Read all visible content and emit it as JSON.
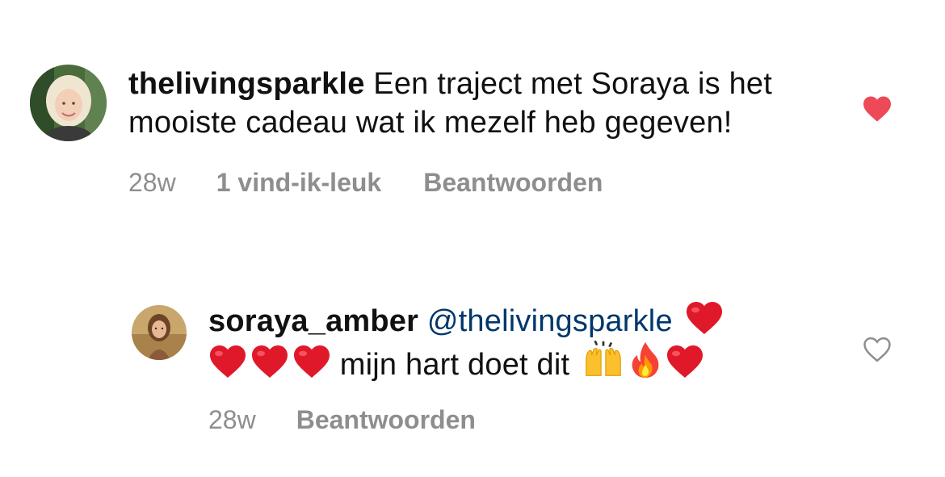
{
  "comments": [
    {
      "username": "thelivingsparkle",
      "text": "Een traject met Soraya is het mooiste cadeau wat ik mezelf heb gegeven!",
      "time": "28w",
      "likes": "1 vind-ik-leuk",
      "reply_label": "Beantwoorden",
      "liked": true
    },
    {
      "username": "soraya_amber",
      "mention": "@thelivingsparkle",
      "text_mid": "mijn hart doet dit",
      "emoji_before": [
        "red-heart",
        "red-heart",
        "red-heart",
        "red-heart"
      ],
      "emoji_after": [
        "raising-hands",
        "fire",
        "red-heart"
      ],
      "time": "28w",
      "reply_label": "Beantwoorden",
      "liked": false
    }
  ],
  "colors": {
    "like_red": "#ed4956",
    "meta_gray": "#8e8e8e",
    "mention_blue": "#00376b"
  }
}
